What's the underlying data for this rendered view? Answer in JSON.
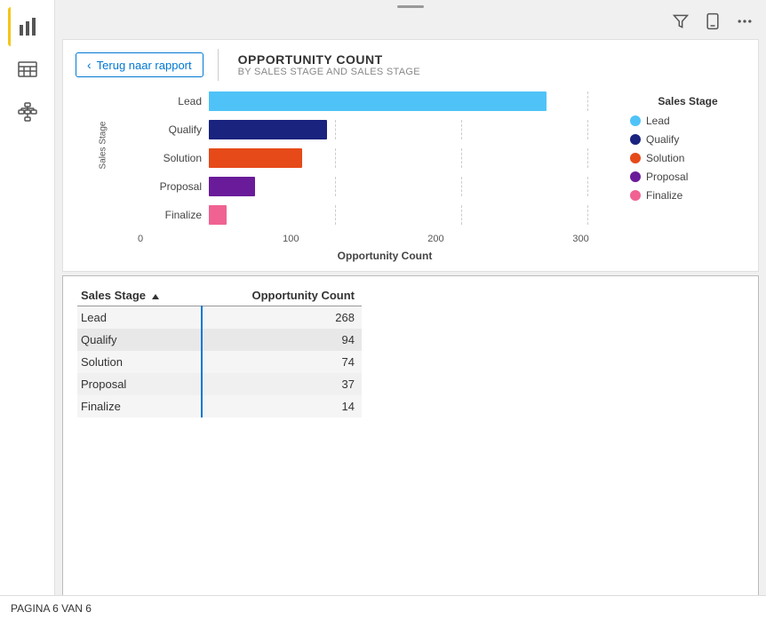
{
  "sidebar": {
    "icons": [
      {
        "name": "bar-chart-icon",
        "label": "Bar chart"
      },
      {
        "name": "table-icon",
        "label": "Table"
      },
      {
        "name": "hierarchy-icon",
        "label": "Hierarchy"
      }
    ]
  },
  "topbar": {
    "icons": [
      {
        "name": "filter-icon",
        "label": "Filter"
      },
      {
        "name": "phone-icon",
        "label": "Phone"
      },
      {
        "name": "more-icon",
        "label": "More"
      }
    ]
  },
  "back_button": {
    "label": "Terug naar rapport"
  },
  "chart": {
    "title": "OPPORTUNITY COUNT",
    "subtitle": "BY SALES STAGE AND SALES STAGE",
    "y_axis_label": "Sales Stage",
    "x_axis_label": "Opportunity Count",
    "x_axis_ticks": [
      "0",
      "100",
      "200",
      "300"
    ],
    "max_value": 320,
    "bars": [
      {
        "label": "Lead",
        "value": 268,
        "color": "#4FC3F7"
      },
      {
        "label": "Qualify",
        "value": 94,
        "color": "#1A237E"
      },
      {
        "label": "Solution",
        "value": 74,
        "color": "#E64A19"
      },
      {
        "label": "Proposal",
        "value": 37,
        "color": "#6A1B9A"
      },
      {
        "label": "Finalize",
        "value": 14,
        "color": "#F06292"
      }
    ],
    "legend_title": "Sales Stage",
    "legend_items": [
      {
        "label": "Lead",
        "color": "#4FC3F7"
      },
      {
        "label": "Qualify",
        "color": "#1A237E"
      },
      {
        "label": "Solution",
        "color": "#E64A19"
      },
      {
        "label": "Proposal",
        "color": "#6A1B9A"
      },
      {
        "label": "Finalize",
        "color": "#F06292"
      }
    ]
  },
  "table": {
    "headers": [
      "Sales Stage",
      "Opportunity Count"
    ],
    "rows": [
      {
        "stage": "Lead",
        "count": "268"
      },
      {
        "stage": "Qualify",
        "count": "94"
      },
      {
        "stage": "Solution",
        "count": "74"
      },
      {
        "stage": "Proposal",
        "count": "37"
      },
      {
        "stage": "Finalize",
        "count": "14"
      }
    ]
  },
  "status_bar": {
    "text": "PAGINA 6 VAN 6"
  }
}
